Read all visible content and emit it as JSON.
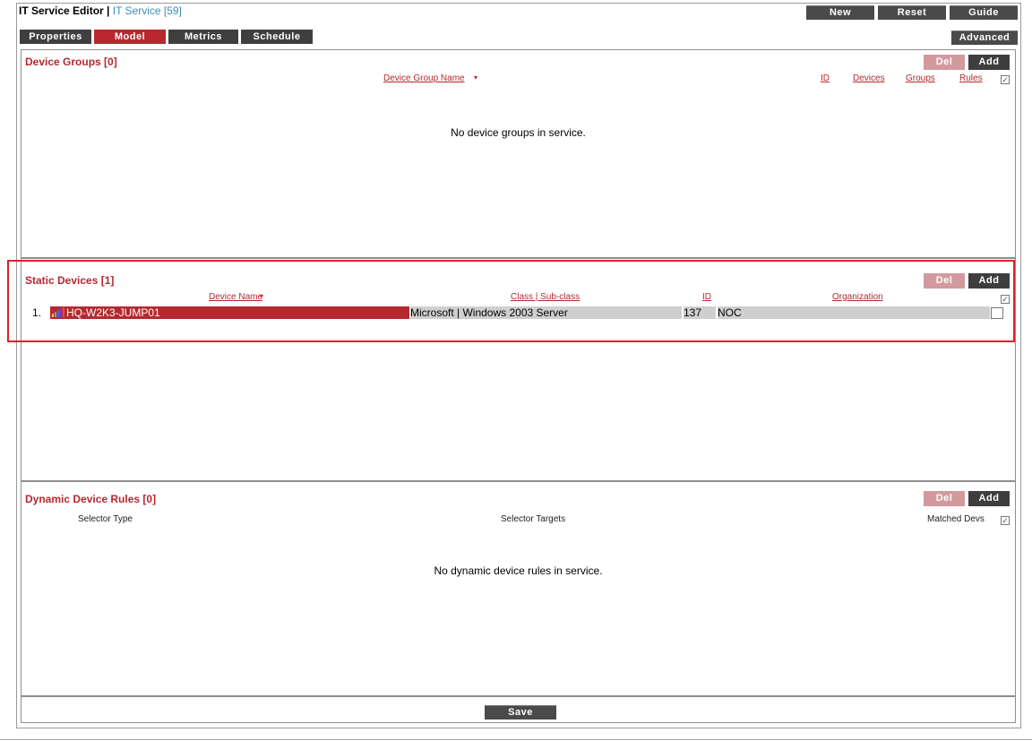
{
  "header": {
    "title": "IT Service Editor",
    "separator": " | ",
    "service": "IT Service [59]",
    "buttons": {
      "new": "New",
      "reset": "Reset",
      "guide": "Guide"
    }
  },
  "tabs": [
    {
      "label": "Properties",
      "active": false
    },
    {
      "label": "Model",
      "active": true
    },
    {
      "label": "Metrics",
      "active": false
    },
    {
      "label": "Schedule",
      "active": false
    }
  ],
  "advanced_label": "Advanced",
  "device_groups": {
    "title": "Device Groups [0]",
    "del_label": "Del",
    "add_label": "Add",
    "columns": {
      "name": "Device Group Name",
      "id": "ID",
      "devices": "Devices",
      "groups": "Groups",
      "rules": "Rules"
    },
    "empty_message": "No device groups in service."
  },
  "static_devices": {
    "title": "Static Devices [1]",
    "del_label": "Del",
    "add_label": "Add",
    "columns": {
      "name": "Device Name",
      "class": "Class | Sub-class",
      "id": "ID",
      "organization": "Organization"
    },
    "rows": [
      {
        "index": "1.",
        "name": "HQ-W2K3-JUMP01",
        "class": "Microsoft | Windows 2003 Server",
        "id": "137",
        "organization": "NOC"
      }
    ]
  },
  "dynamic_rules": {
    "title": "Dynamic Device Rules [0]",
    "del_label": "Del",
    "add_label": "Add",
    "columns": {
      "selector_type": "Selector Type",
      "selector_targets": "Selector Targets",
      "matched": "Matched Devs"
    },
    "empty_message": "No dynamic device rules in service."
  },
  "save_label": "Save",
  "colors": {
    "accent": "#b5282e",
    "link": "#3a8fb7",
    "dark_button": "#3e3e3e",
    "del_button": "#d29a9d"
  }
}
